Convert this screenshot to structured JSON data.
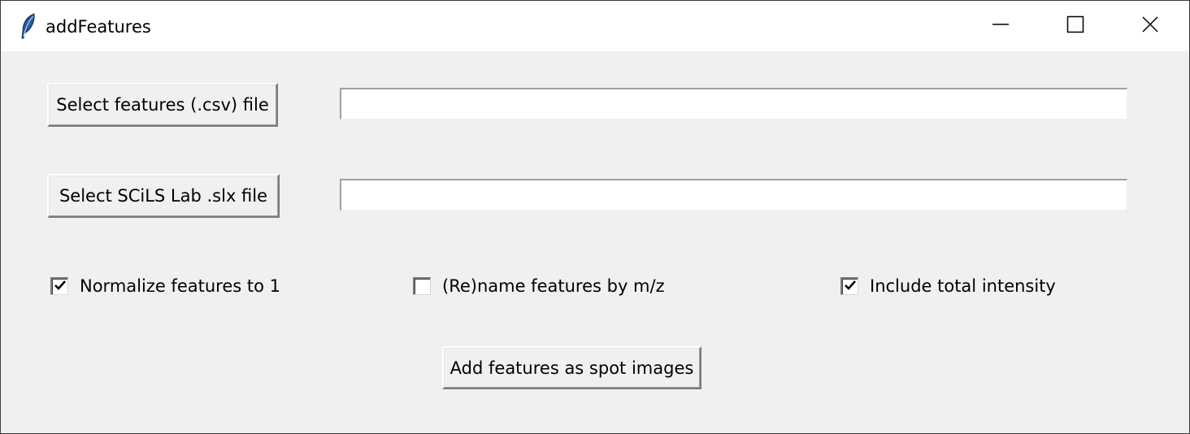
{
  "window": {
    "title": "addFeatures",
    "icon": "feather-icon",
    "controls": {
      "minimize": "minimize-icon",
      "maximize": "maximize-icon",
      "close": "close-icon"
    }
  },
  "form": {
    "features_button_label": "Select features (.csv) file",
    "features_path_value": "",
    "slx_button_label": "Select SCiLS Lab .slx file",
    "slx_path_value": "",
    "options": [
      {
        "label": "Normalize features to 1",
        "checked": true
      },
      {
        "label": "(Re)name features by m/z",
        "checked": false
      },
      {
        "label": "Include total intensity",
        "checked": true
      }
    ],
    "submit_label": "Add features as spot images"
  },
  "colors": {
    "titlebar_bg": "#ffffff",
    "window_bg": "#f0f0f0",
    "accent_icon": "#1f4f8f"
  }
}
